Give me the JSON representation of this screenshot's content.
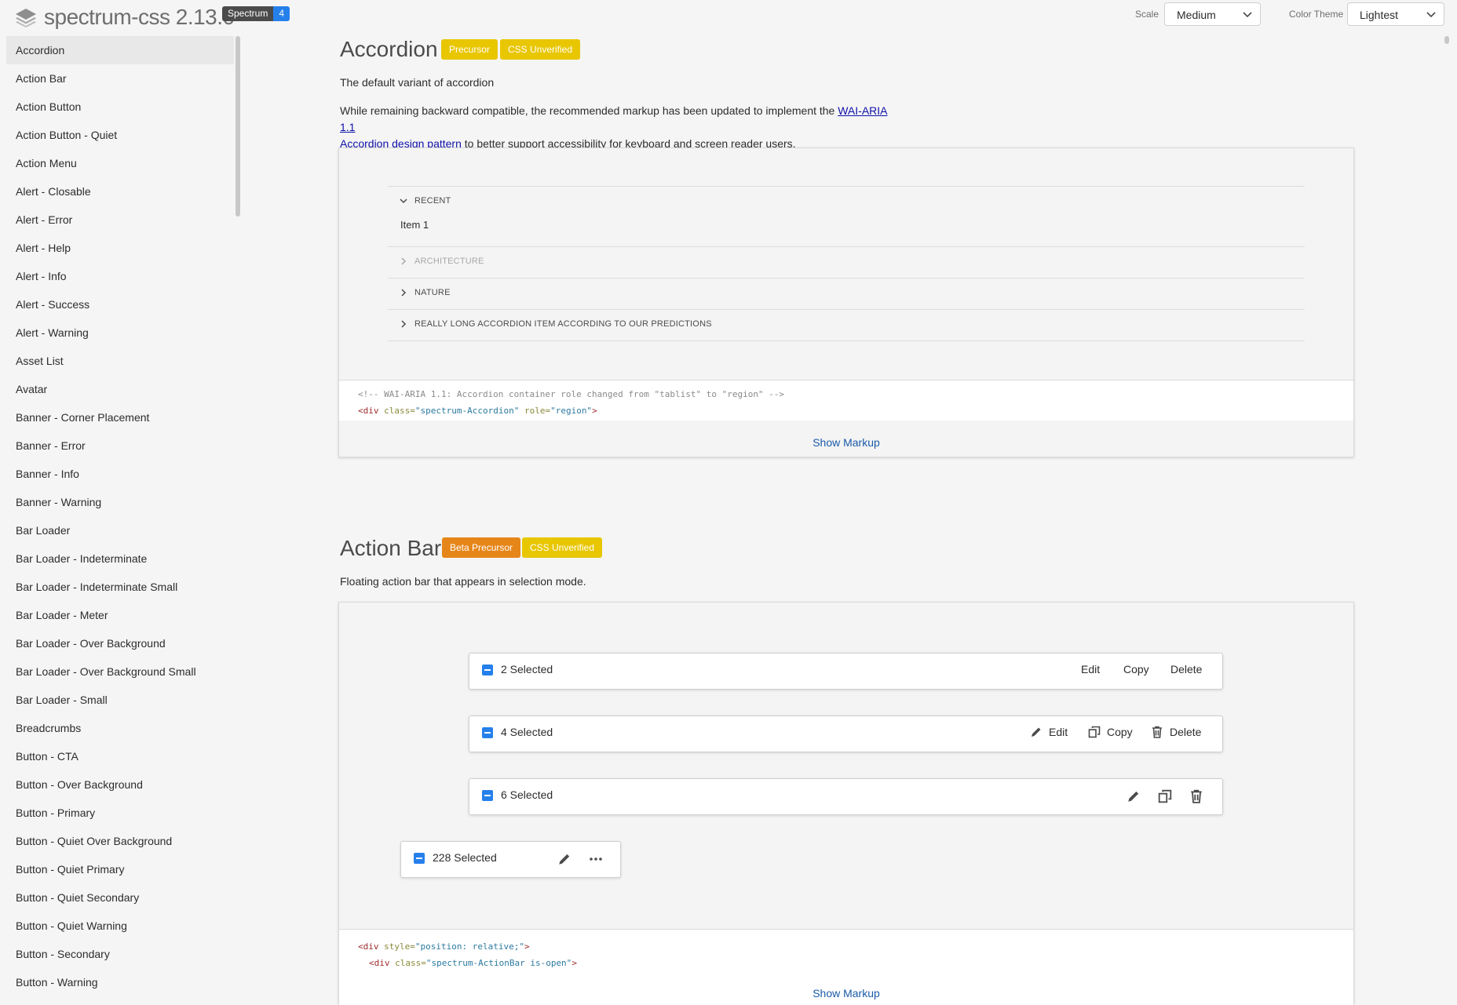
{
  "header": {
    "title": "spectrum-css 2.13.0",
    "brand_badge": {
      "label": "Spectrum",
      "version": "4"
    },
    "scale": {
      "label": "Scale",
      "value": "Medium"
    },
    "color_theme": {
      "label": "Color Theme",
      "value": "Lightest"
    }
  },
  "sidebar": {
    "items": [
      "Accordion",
      "Action Bar",
      "Action Button",
      "Action Button - Quiet",
      "Action Menu",
      "Alert - Closable",
      "Alert - Error",
      "Alert - Help",
      "Alert - Info",
      "Alert - Success",
      "Alert - Warning",
      "Asset List",
      "Avatar",
      "Banner - Corner Placement",
      "Banner - Error",
      "Banner - Info",
      "Banner - Warning",
      "Bar Loader",
      "Bar Loader - Indeterminate",
      "Bar Loader - Indeterminate Small",
      "Bar Loader - Meter",
      "Bar Loader - Over Background",
      "Bar Loader - Over Background Small",
      "Bar Loader - Small",
      "Breadcrumbs",
      "Button - CTA",
      "Button - Over Background",
      "Button - Primary",
      "Button - Quiet Over Background",
      "Button - Quiet Primary",
      "Button - Quiet Secondary",
      "Button - Quiet Warning",
      "Button - Secondary",
      "Button - Warning"
    ],
    "active_index": 0
  },
  "accordion_section": {
    "title": "Accordion",
    "badges": [
      "Precursor",
      "CSS Unverified"
    ],
    "description": "The default variant of accordion",
    "note_prefix": "While remaining backward compatible, the recommended markup has been updated to implement the ",
    "note_link1": "WAI-ARIA 1.1",
    "note_link2": "Accordion design pattern",
    "note_suffix": " to better support accessibility for keyboard and screen reader users.",
    "items": [
      {
        "label": "RECENT",
        "expanded": true,
        "disabled": false,
        "content": "Item 1"
      },
      {
        "label": "ARCHITECTURE",
        "expanded": false,
        "disabled": true
      },
      {
        "label": "NATURE",
        "expanded": false,
        "disabled": false
      },
      {
        "label": "REALLY LONG ACCORDION ITEM ACCORDING TO OUR PREDICTIONS",
        "expanded": false,
        "disabled": false
      }
    ],
    "code": {
      "line1": "<!-- WAI-ARIA 1.1: Accordion container role changed from \"tablist\" to \"region\" -->",
      "line2_tag_open": "<div ",
      "line2_attr1": "class=",
      "line2_val1": "\"spectrum-Accordion\"",
      "line2_attr2": " role=",
      "line2_val2": "\"region\"",
      "line2_close": ">"
    },
    "show_markup": "Show Markup"
  },
  "actionbar_section": {
    "title": "Action Bar",
    "badges": [
      "Beta Precursor",
      "CSS Unverified"
    ],
    "description": "Floating action bar that appears in selection mode.",
    "bars": [
      {
        "count": "2 Selected",
        "actions": [
          "Edit",
          "Copy",
          "Delete"
        ]
      },
      {
        "count": "4 Selected",
        "actions": [
          "Edit",
          "Copy",
          "Delete"
        ]
      },
      {
        "count": "6 Selected"
      },
      {
        "count": "228 Selected"
      }
    ],
    "code": {
      "l1_open": "<div ",
      "l1_attr": "style=",
      "l1_val": "\"position: relative;\"",
      "l1_close": ">",
      "l2_open": "<div ",
      "l2_attr": "class=",
      "l2_val": "\"spectrum-ActionBar is-open\"",
      "l2_close": ">"
    },
    "show_markup": "Show Markup"
  },
  "colors": {
    "accent": "#2680eb",
    "badge_yellow": "#e8c600",
    "badge_orange": "#e68619",
    "link": "#1a5aa8"
  }
}
